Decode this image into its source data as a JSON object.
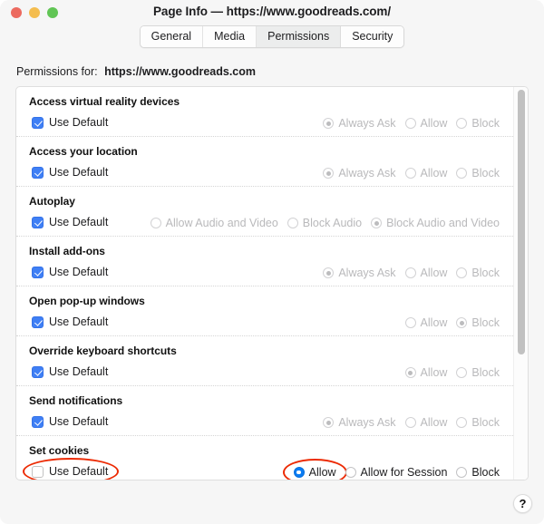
{
  "window": {
    "title": "Page Info — https://www.goodreads.com/",
    "traffic_lights": [
      {
        "name": "close",
        "color": "#ec6a5f"
      },
      {
        "name": "minimize",
        "color": "#f4bd4f"
      },
      {
        "name": "zoom",
        "color": "#61c555"
      }
    ]
  },
  "tabs": [
    {
      "label": "General",
      "selected": false
    },
    {
      "label": "Media",
      "selected": false
    },
    {
      "label": "Permissions",
      "selected": true
    },
    {
      "label": "Security",
      "selected": false
    }
  ],
  "permissions_for": {
    "label": "Permissions for:",
    "host": "https://www.goodreads.com"
  },
  "use_default_label": "Use Default",
  "permissions": [
    {
      "title": "Access virtual reality devices",
      "use_default": true,
      "enabled": false,
      "options": [
        {
          "label": "Always Ask",
          "selected": true
        },
        {
          "label": "Allow",
          "selected": false
        },
        {
          "label": "Block",
          "selected": false
        }
      ]
    },
    {
      "title": "Access your location",
      "use_default": true,
      "enabled": false,
      "options": [
        {
          "label": "Always Ask",
          "selected": true
        },
        {
          "label": "Allow",
          "selected": false
        },
        {
          "label": "Block",
          "selected": false
        }
      ]
    },
    {
      "title": "Autoplay",
      "use_default": true,
      "enabled": false,
      "options": [
        {
          "label": "Allow Audio and Video",
          "selected": false
        },
        {
          "label": "Block Audio",
          "selected": false
        },
        {
          "label": "Block Audio and Video",
          "selected": true
        }
      ]
    },
    {
      "title": "Install add-ons",
      "use_default": true,
      "enabled": false,
      "options": [
        {
          "label": "Always Ask",
          "selected": true
        },
        {
          "label": "Allow",
          "selected": false
        },
        {
          "label": "Block",
          "selected": false
        }
      ]
    },
    {
      "title": "Open pop-up windows",
      "use_default": true,
      "enabled": false,
      "options": [
        {
          "label": "Allow",
          "selected": false
        },
        {
          "label": "Block",
          "selected": true
        }
      ]
    },
    {
      "title": "Override keyboard shortcuts",
      "use_default": true,
      "enabled": false,
      "options": [
        {
          "label": "Allow",
          "selected": true
        },
        {
          "label": "Block",
          "selected": false
        }
      ]
    },
    {
      "title": "Send notifications",
      "use_default": true,
      "enabled": false,
      "options": [
        {
          "label": "Always Ask",
          "selected": true
        },
        {
          "label": "Allow",
          "selected": false
        },
        {
          "label": "Block",
          "selected": false
        }
      ]
    },
    {
      "title": "Set cookies",
      "use_default": false,
      "enabled": true,
      "highlight_checkbox": true,
      "options": [
        {
          "label": "Allow",
          "selected": true,
          "highlight": true
        },
        {
          "label": "Allow for Session",
          "selected": false
        },
        {
          "label": "Block",
          "selected": false
        }
      ]
    }
  ],
  "help_button": {
    "label": "?"
  },
  "annotation_color": "#ec2a03"
}
